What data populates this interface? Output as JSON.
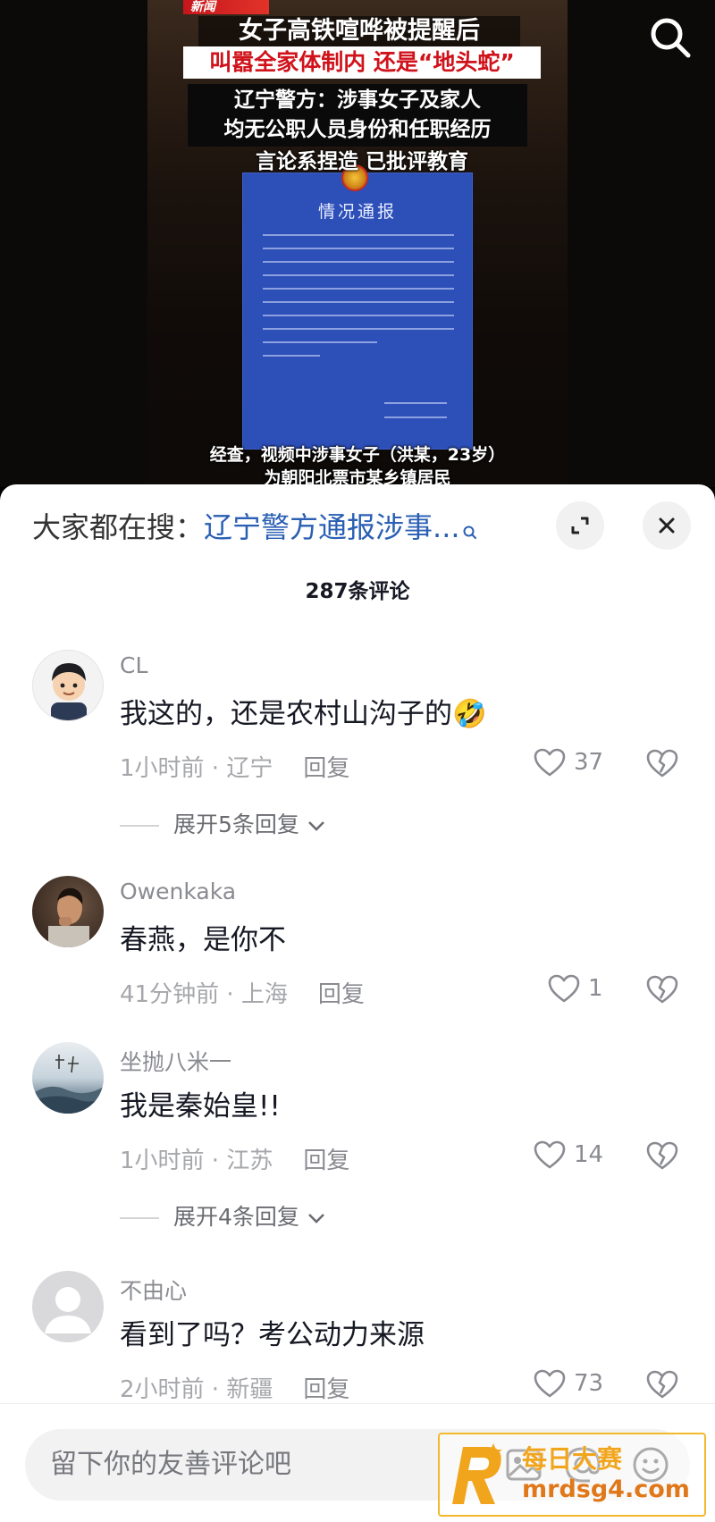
{
  "video": {
    "logo_text": "新闻",
    "headline_1": "女子高铁喧哗被提醒后",
    "headline_2": "叫嚣全家体制内 还是“地头蛇”",
    "headline_3a": "辽宁警方：涉事女子及家人",
    "headline_3b": "均无公职人员身份和任职经历",
    "headline_4": "言论系捏造 已批评教育",
    "notice_title": "情况通报",
    "caption_1": "经查，视频中涉事女子（洪某，23岁）",
    "caption_2": "为朝阳北票市某乡镇居民",
    "search_icon": "search-icon"
  },
  "sheet": {
    "hot_search_prefix": "大家都在搜：",
    "hot_search_link": "辽宁警方通报涉事...",
    "comment_count": "287条评论",
    "expand_icon": "expand-icon",
    "close_icon": "close-icon"
  },
  "comments": [
    {
      "username": "CL",
      "content": "我这的，还是农村山沟子的🤣",
      "meta": "1小时前 · 辽宁",
      "reply": "回复",
      "likes": "37",
      "expand": "展开5条回复"
    },
    {
      "username": "Owenkaka",
      "content": "春燕，是你不",
      "meta": "41分钟前 · 上海",
      "reply": "回复",
      "likes": "1"
    },
    {
      "username": "坐抛八米一",
      "content": "我是秦始皇!!",
      "meta": "1小时前 · 江苏",
      "reply": "回复",
      "likes": "14",
      "expand": "展开4条回复"
    },
    {
      "username": "不由心",
      "content": "看到了吗？考公动力来源",
      "meta": "2小时前 · 新疆",
      "reply": "回复",
      "likes": "73"
    }
  ],
  "input": {
    "placeholder": "留下你的友善评论吧"
  },
  "watermark": {
    "title": "每日大赛",
    "site": "mrdsg4.com"
  },
  "colors": {
    "link": "#2a5fb3",
    "notice_blue": "#2d4fb8",
    "headline_red": "#d0121b",
    "watermark_gold": "#f1a51c"
  }
}
